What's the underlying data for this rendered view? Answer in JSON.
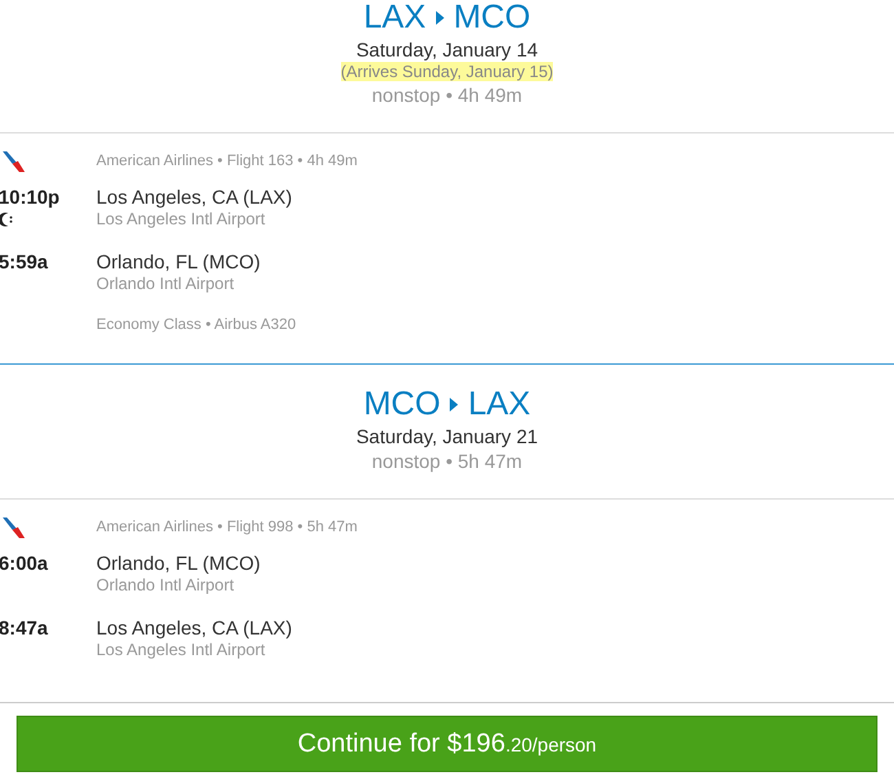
{
  "legs": [
    {
      "from": "LAX",
      "to": "MCO",
      "date": "Saturday, January 14",
      "arrives_note": "(Arrives Sunday, January 15)",
      "summary": "nonstop • 4h 49m",
      "flight": {
        "info": "American Airlines • Flight 163 • 4h 49m",
        "overnight": true,
        "cabin": "Economy Class • Airbus A320",
        "stops": [
          {
            "time": "10:10p",
            "city": "Los Angeles, CA (LAX)",
            "airport": "Los Angeles Intl Airport"
          },
          {
            "time": "5:59a",
            "city": "Orlando, FL (MCO)",
            "airport": "Orlando Intl Airport"
          }
        ]
      }
    },
    {
      "from": "MCO",
      "to": "LAX",
      "date": "Saturday, January 21",
      "summary": "nonstop • 5h 47m",
      "flight": {
        "info": "American Airlines • Flight 998 • 5h 47m",
        "overnight": false,
        "stops": [
          {
            "time": "6:00a",
            "city": "Orlando, FL (MCO)",
            "airport": "Orlando Intl Airport"
          },
          {
            "time": "8:47a",
            "city": "Los Angeles, CA (LAX)",
            "airport": "Los Angeles Intl Airport"
          }
        ]
      }
    }
  ],
  "continue_button": {
    "label": "Continue for $196",
    "cents": ".20/person"
  }
}
